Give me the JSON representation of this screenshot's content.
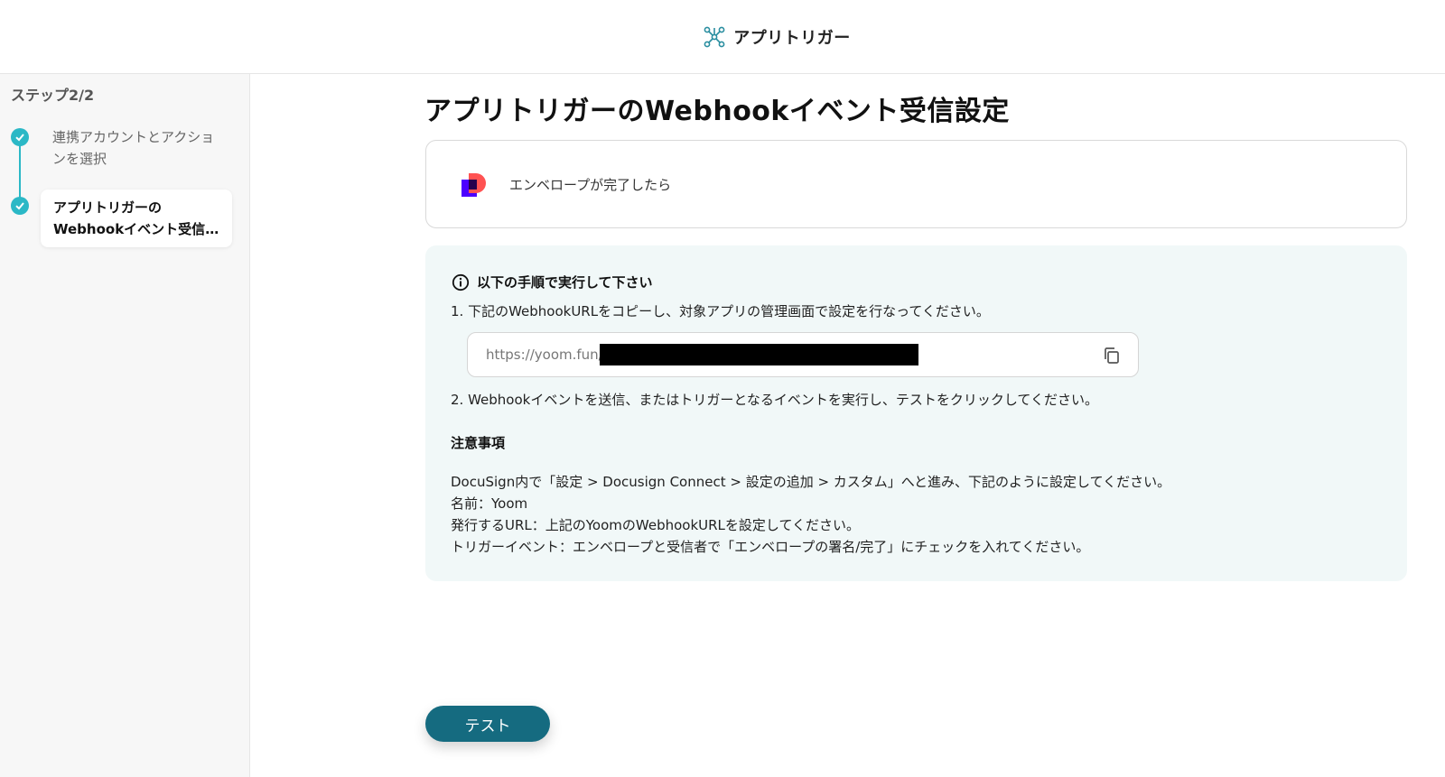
{
  "header": {
    "brand_name": "アプリトリガー",
    "brand_icon": "network-nodes-icon"
  },
  "sidebar": {
    "step_count": "ステップ2/2",
    "steps": [
      {
        "label": "連携アカウントとアクションを選択",
        "status": "done"
      },
      {
        "label_line1": "アプリトリガーの",
        "label_line2": "Webhookイベント受信...",
        "status": "active"
      }
    ]
  },
  "main": {
    "title": "アプリトリガーのWebhookイベント受信設定",
    "trigger_card": {
      "text": "エンベロープが完了したら",
      "logo_icon": "docusign-logo-icon"
    },
    "instructions": {
      "heading": "以下の手順で実行して下さい",
      "step1": "1. 下記のWebhookURLをコピーし、対象アプリの管理画面で設定を行なってください。",
      "url_prefix": "https://yoom.fun/",
      "step2": "2. Webhookイベントを送信、またはトリガーとなるイベントを実行し、テストをクリックしてください。",
      "notes_title": "注意事項",
      "notes": [
        "DocuSign内で「設定 > Docusign Connect > 設定の追加 > カスタム」へと進み、下記のように設定してください。",
        "名前：Yoom",
        "発行するURL：上記のYoomのWebhookURLを設定してください。",
        "トリガーイベント：エンベロープと受信者で「エンベロープの署名/完了」にチェックを入れてください。"
      ]
    },
    "test_button": "テスト"
  },
  "colors": {
    "accent": "#2bb8c6",
    "button": "#156b80",
    "panel": "#f1f8f8"
  }
}
